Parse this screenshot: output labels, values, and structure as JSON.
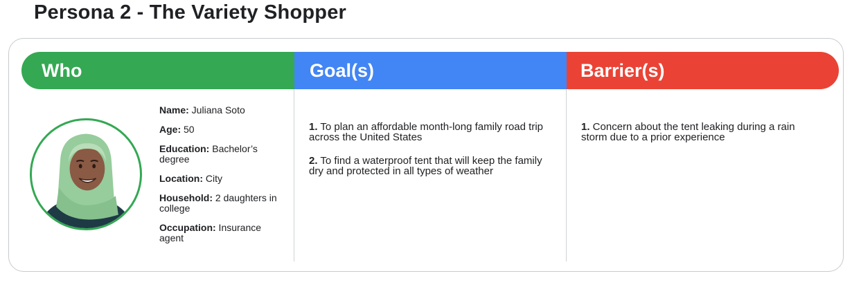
{
  "page": {
    "title": "Persona 2 - The Variety Shopper"
  },
  "columns": {
    "who": {
      "label": "Who",
      "color": "#34a853"
    },
    "goals": {
      "label": "Goal(s)",
      "color": "#4285f4"
    },
    "barriers": {
      "label": "Barrier(s)",
      "color": "#ea4335"
    }
  },
  "profile": {
    "avatar_icon": "persona-avatar-icon",
    "fields": [
      {
        "key": "Name:",
        "value": " Juliana Soto"
      },
      {
        "key": "Age:",
        "value": " 50"
      },
      {
        "key": "Education:",
        "value": " Bachelor’s degree"
      },
      {
        "key": "Location:",
        "value": " City"
      },
      {
        "key": "Household:",
        "value": " 2 daughters in college"
      },
      {
        "key": "Occupation:",
        "value": " Insurance agent"
      }
    ]
  },
  "goals": [
    {
      "num": "1.",
      "text": " To plan an affordable month-long family road trip across the United States"
    },
    {
      "num": "2.",
      "text": " To find a waterproof tent that will keep the family dry and protected in all types of weather"
    }
  ],
  "barriers": [
    {
      "num": "1.",
      "text": " Concern about the tent leaking during a rain storm due to a prior experience"
    }
  ]
}
